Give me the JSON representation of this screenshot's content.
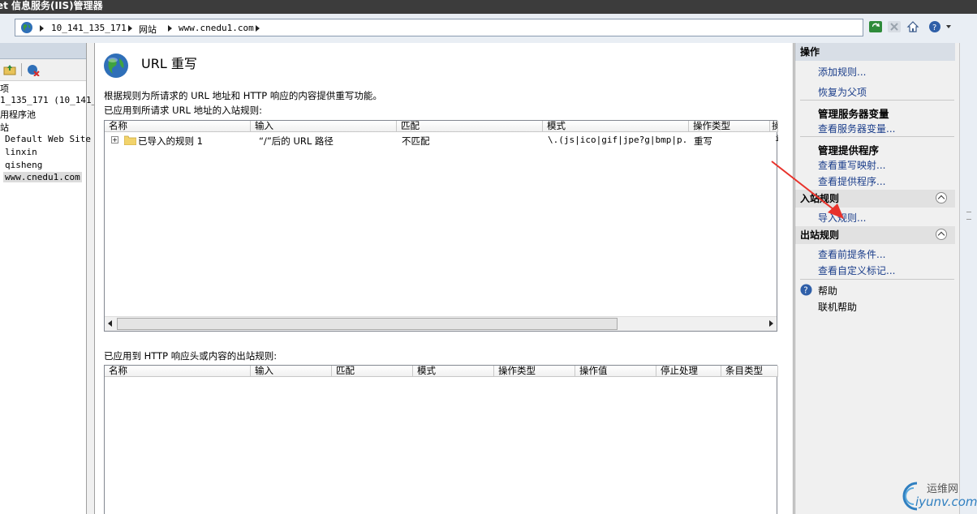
{
  "window": {
    "title": "et 信息服务(IIS)管理器"
  },
  "address": {
    "segments": [
      "10_141_135_171",
      "网站",
      "www.cnedu1.com"
    ]
  },
  "tree": {
    "items": [
      "项",
      "1_135_171 (10_141_",
      "用程序池",
      "站",
      "Default Web Site",
      "linxin",
      "qisheng",
      "www.cnedu1.com"
    ]
  },
  "main": {
    "title": "URL 重写",
    "description": "根据规则为所请求的 URL 地址和 HTTP 响应的内容提供重写功能。",
    "inbound_label": "已应用到所请求 URL 地址的入站规则:",
    "inbound_columns": [
      "名称",
      "输入",
      "匹配",
      "模式",
      "操作类型",
      "操"
    ],
    "inbound_rows": [
      {
        "name": "已导入的规则 1",
        "input": "“/”后的 URL 路径",
        "match": "不匹配",
        "pattern": "\\.(js|ico|gif|jpe?g|bmp|p...",
        "action": "重写",
        "extra": "i"
      }
    ],
    "outbound_label": "已应用到 HTTP 响应头或内容的出站规则:",
    "outbound_columns": [
      "名称",
      "输入",
      "匹配",
      "模式",
      "操作类型",
      "操作值",
      "停止处理",
      "条目类型"
    ]
  },
  "actions": {
    "header": "操作",
    "add_rule": "添加规则...",
    "revert_parent": "恢复为父项",
    "manage_server_vars": "管理服务器变量",
    "view_server_vars": "查看服务器变量...",
    "manage_providers": "管理提供程序",
    "view_rewrite_maps": "查看重写映射...",
    "view_providers": "查看提供程序...",
    "inbound_header": "入站规则",
    "import_rules": "导入规则...",
    "outbound_header": "出站规则",
    "view_preconditions": "查看前提条件...",
    "view_custom_tags": "查看自定义标记...",
    "help": "帮助",
    "online_help": "联机帮助"
  },
  "watermark": {
    "brand": "运维网",
    "domain": "iyunv.com"
  },
  "colors": {
    "annotation_arrow": "#e8322b",
    "link": "#1a3d8a"
  }
}
